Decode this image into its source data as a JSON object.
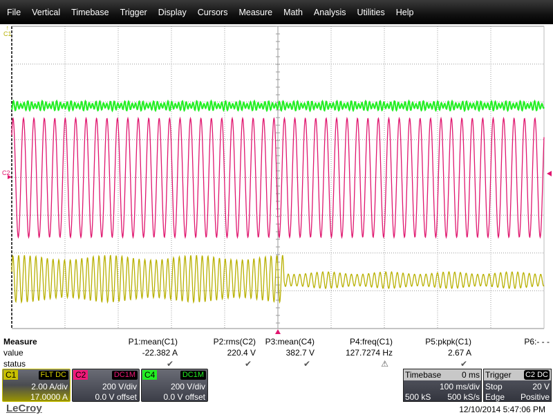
{
  "menu": [
    "File",
    "Vertical",
    "Timebase",
    "Trigger",
    "Display",
    "Cursors",
    "Measure",
    "Math",
    "Analysis",
    "Utilities",
    "Help"
  ],
  "grid": {
    "markers": {
      "c1": "C1",
      "c2": "C2"
    }
  },
  "colors": {
    "c1": "#b8b000",
    "c2": "#e0156e",
    "c4": "#22ee22",
    "trigger_marker": "#e0156e"
  },
  "measure": {
    "title": "Measure",
    "value_label": "value",
    "status_label": "status",
    "params": [
      {
        "name": "P1:mean(C1)",
        "value": "-22.382 A",
        "status": "check"
      },
      {
        "name": "P2:rms(C2)",
        "value": "220.4 V",
        "status": "check"
      },
      {
        "name": "P3:mean(C4)",
        "value": "382.7 V",
        "status": "check"
      },
      {
        "name": "P4:freq(C1)",
        "value": "127.7274 Hz",
        "status": "warning"
      },
      {
        "name": "P5:pkpk(C1)",
        "value": "2.67 A",
        "status": "check"
      },
      {
        "name": "P6:- - -",
        "value": "",
        "status": ""
      }
    ]
  },
  "channels": [
    {
      "tag": "C1",
      "coupling": "FLT DC",
      "scale": "2.00 A/div",
      "offset": "17.0000 A"
    },
    {
      "tag": "C2",
      "coupling": "DC1M",
      "scale": "200 V/div",
      "offset": "0.0 V offset"
    },
    {
      "tag": "C4",
      "coupling": "DC1M",
      "scale": "200 V/div",
      "offset": "0.0 V offset"
    }
  ],
  "timebase": {
    "label": "Timebase",
    "delay": "0 ms",
    "scale": "100 ms/div",
    "samples": "500 kS",
    "rate": "500 kS/s"
  },
  "trigger": {
    "label": "Trigger",
    "source": "C2 DC",
    "mode": "Stop",
    "level": "20 V",
    "type": "Edge",
    "slope": "Positive"
  },
  "brand": "LeCroy",
  "datetime": "12/10/2014 5:47:06 PM"
}
